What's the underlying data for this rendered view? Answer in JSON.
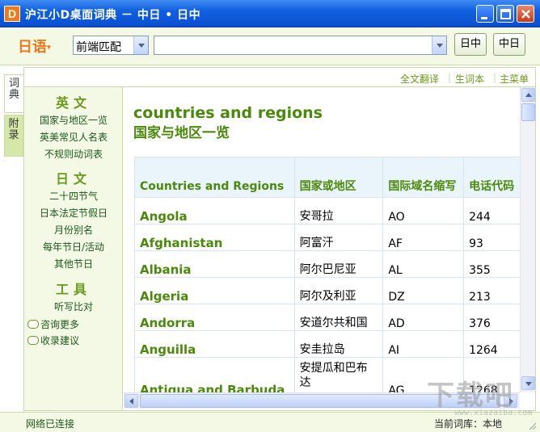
{
  "window": {
    "icon_letter": "D",
    "title": "沪江小D桌面词典 － 中日 • 日中"
  },
  "search": {
    "language": "日语",
    "match_mode": "前端匹配",
    "query_value": "",
    "btn_jp_cn": "日中",
    "btn_cn_jp": "中日"
  },
  "side_tabs": {
    "dict": "词典",
    "appendix": "附录"
  },
  "top_links": [
    "全文翻译",
    "生词本",
    "主菜单"
  ],
  "nav": {
    "english_heading": "英文",
    "english_items": [
      "国家与地区一览",
      "英美常见人名表",
      "不规则动词表"
    ],
    "japanese_heading": "日文",
    "japanese_items": [
      "二十四节气",
      "日本法定节假日",
      "月份别名",
      "每年节日/活动",
      "其他节日"
    ],
    "tools_heading": "工具",
    "tools_items": [
      "听写比对"
    ],
    "feedback_items": [
      "咨询更多",
      "收录建议"
    ]
  },
  "content": {
    "heading_en": "countries and regions",
    "heading_cn": "国家与地区一览",
    "columns": [
      "Countries and Regions",
      "国家或地区",
      "国际域名缩写",
      "电话代码"
    ],
    "rows": [
      {
        "en": "Angola",
        "cn": "安哥拉",
        "code": "AO",
        "phone": "244"
      },
      {
        "en": "Afghanistan",
        "cn": "阿富汗",
        "code": "AF",
        "phone": "93"
      },
      {
        "en": "Albania",
        "cn": "阿尔巴尼亚",
        "code": "AL",
        "phone": "355"
      },
      {
        "en": "Algeria",
        "cn": "阿尔及利亚",
        "code": "DZ",
        "phone": "213"
      },
      {
        "en": "Andorra",
        "cn": "安道尔共和国",
        "code": "AD",
        "phone": "376"
      },
      {
        "en": "Anguilla",
        "cn": "安圭拉岛",
        "code": "AI",
        "phone": "1264"
      },
      {
        "en": "Antigua and Barbuda",
        "cn": "安提瓜和巴布达",
        "code": "AG",
        "phone": "1268"
      }
    ]
  },
  "status": {
    "connection": "网络已连接",
    "current_dict": "当前词库：本地"
  },
  "watermark": {
    "text": "下载吧",
    "url": "www.xiazaiba.com"
  },
  "colors": {
    "accent_green": "#4a8a0a",
    "titlebar_blue": "#0a4fd0",
    "lang_orange": "#f07a1a"
  }
}
